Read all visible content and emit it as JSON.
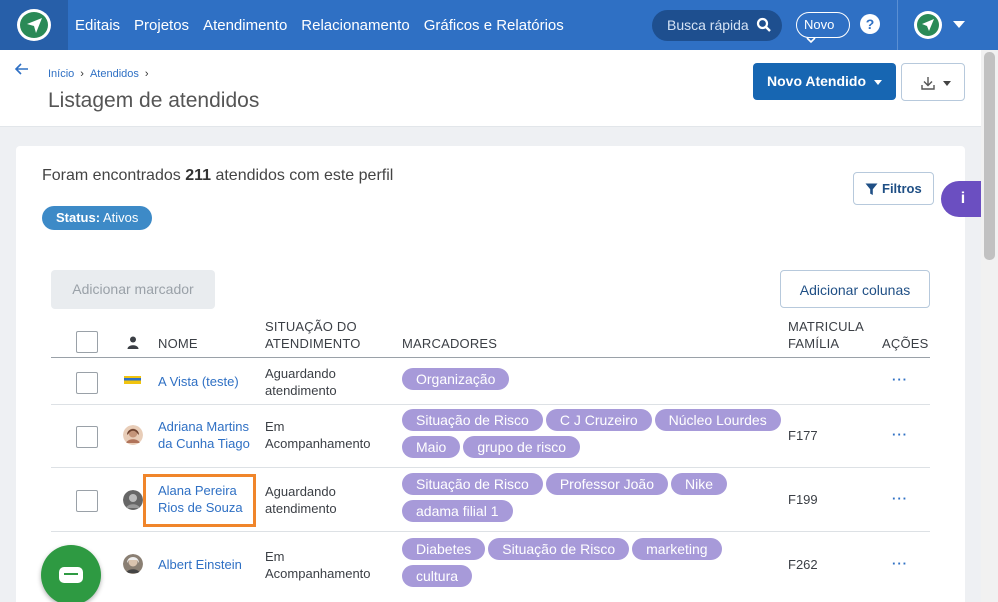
{
  "navbar": {
    "links": [
      "Editais",
      "Projetos",
      "Atendimento",
      "Relacionamento",
      "Gráficos e Relatórios"
    ],
    "search_placeholder": "Busca rápida",
    "novo_label": "Novo",
    "help_label": "?"
  },
  "header": {
    "breadcrumb": [
      "Início",
      "Atendidos"
    ],
    "title": "Listagem de atendidos",
    "primary_button": "Novo Atendido"
  },
  "summary": {
    "prefix": "Foram encontrados",
    "count": "211",
    "suffix": "atendidos com este perfil",
    "status_label": "Status:",
    "status_value": "Ativos",
    "filters_button": "Filtros"
  },
  "actions": {
    "add_marker": "Adicionar marcador",
    "add_columns": "Adicionar colunas"
  },
  "table": {
    "headers": {
      "name": "NOME",
      "situation_1": "SITUAÇÃO DO",
      "situation_2": "ATENDIMENTO",
      "markers": "MARCADORES",
      "matricula_1": "MATRICULA",
      "matricula_2": "FAMÍLIA",
      "actions": "AÇÕES"
    },
    "rows": [
      {
        "name_1": "A Vista (teste)",
        "name_2": "",
        "situation_1": "Aguardando",
        "situation_2": "atendimento",
        "tags": [
          "Organização"
        ],
        "matricula": "",
        "actions": "···"
      },
      {
        "name_1": "Adriana Martins",
        "name_2": "da Cunha Tiago",
        "situation_1": "Em",
        "situation_2": "Acompanhamento",
        "tags": [
          "Situação de Risco",
          "C J Cruzeiro",
          "Núcleo Lourdes",
          "Maio",
          "grupo de risco"
        ],
        "matricula": "F177",
        "actions": "···"
      },
      {
        "name_1": "Alana Pereira",
        "name_2": "Rios de Souza",
        "situation_1": "Aguardando",
        "situation_2": "atendimento",
        "tags": [
          "Situação de Risco",
          "Professor João",
          "Nike",
          "adama filial 1"
        ],
        "matricula": "F199",
        "actions": "···"
      },
      {
        "name_1": "Albert Einstein",
        "name_2": "",
        "situation_1": "Em",
        "situation_2": "Acompanhamento",
        "tags": [
          "Diabetes",
          "Situação de Risco",
          "marketing",
          "cultura"
        ],
        "matricula": "F262",
        "actions": "···"
      }
    ]
  },
  "colors": {
    "navbar": "#2f70c4",
    "primary": "#1766b2",
    "tag": "#a79ad9",
    "highlight": "#f0852a",
    "chat": "#2e9a42",
    "info_tab": "#6b4fc1"
  },
  "info_tab_label": "i"
}
